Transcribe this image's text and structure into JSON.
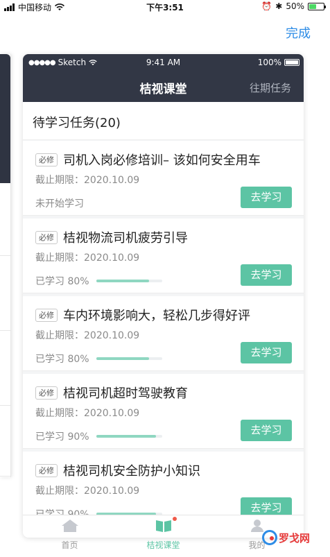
{
  "status_bar": {
    "carrier": "中国移动",
    "time": "下午3:51",
    "battery": "50%",
    "battery_level": 0.5
  },
  "top_action": {
    "done_label": "完成"
  },
  "phone": {
    "status": {
      "carrier": "Sketch",
      "time": "9:41 AM",
      "battery": "100%"
    },
    "title": "桔视课堂",
    "history_label": "往期任务",
    "section_title": "待学习任务(20)",
    "tasks": [
      {
        "tag": "必修",
        "title": "司机入岗必修培训– 该如何安全用车",
        "deadline": "截止期限：2020.10.09",
        "status": "未开始学习",
        "progress": null,
        "button": "去学习"
      },
      {
        "tag": "必修",
        "title": "桔视物流司机疲劳引导",
        "deadline": "截止期限：2020.10.09",
        "status": "已学习 80%",
        "progress": 0.8,
        "button": "去学习"
      },
      {
        "tag": "必修",
        "title": "车内环境影响大，轻松几步得好评",
        "deadline": "截止期限：2020.10.09",
        "status": "已学习 80%",
        "progress": 0.8,
        "button": "去学习"
      },
      {
        "tag": "必修",
        "title": "桔视司机超时驾驶教育",
        "deadline": "截止期限：2020.10.09",
        "status": "已学习 90%",
        "progress": 0.9,
        "button": "去学习"
      },
      {
        "tag": "必修",
        "title": "桔视司机安全防护小知识",
        "deadline": "截止期限：2020.10.09",
        "status": "已学习 90%",
        "progress": 0.9,
        "button": "去学习"
      }
    ],
    "tabs": [
      {
        "label": "首页",
        "icon": "home-icon",
        "active": false
      },
      {
        "label": "桔视课堂",
        "icon": "book-icon",
        "active": true
      },
      {
        "label": "我的",
        "icon": "person-icon",
        "active": false
      }
    ]
  },
  "watermark": {
    "text": "罗戈网"
  },
  "colors": {
    "accent": "#5cc4a4",
    "header": "#323745",
    "link": "#2d8ce6"
  }
}
